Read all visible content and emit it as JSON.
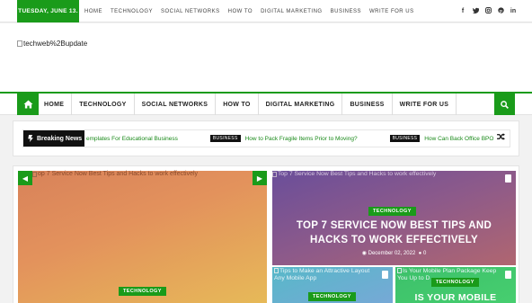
{
  "topbar": {
    "date": "TUESDAY, JUNE 13.",
    "nav": [
      "HOME",
      "TECHNOLOGY",
      "SOCIAL NETWORKS",
      "HOW TO",
      "DIGITAL MARKETING",
      "BUSINESS",
      "WRITE FOR US"
    ],
    "social_icons": [
      "facebook-icon",
      "twitter-icon",
      "instagram-icon",
      "pinterest-icon",
      "linkedin-icon"
    ]
  },
  "logo": {
    "alt": "techweb%2Bupdate"
  },
  "mainnav": {
    "items": [
      "HOME",
      "TECHNOLOGY",
      "SOCIAL NETWORKS",
      "HOW TO",
      "DIGITAL MARKETING",
      "BUSINESS",
      "WRITE FOR US"
    ],
    "home_icon": "home-icon",
    "search_icon": "search-icon"
  },
  "ticker": {
    "label": "Breaking News",
    "items": [
      {
        "badge": "",
        "text": "emplates For Educational Business"
      },
      {
        "badge": "BUSINESS",
        "text": "How to Pack Fragile Items Prior to Moving?"
      },
      {
        "badge": "BUSINESS",
        "text": "How Can Back Office BPO"
      }
    ]
  },
  "slider": {
    "caption": "op 7 Service Now Best Tips and Hacks to work effectively",
    "category": "TECHNOLOGY"
  },
  "featured": {
    "caption": "Top 7 Service Now Best Tips and Hacks to work effectively",
    "category": "TECHNOLOGY",
    "title": "TOP 7 SERVICE NOW BEST TIPS AND HACKS TO WORK EFFECTIVELY",
    "date": "December 02, 2022",
    "comments": "0"
  },
  "card2": {
    "caption_line1": "Tips to Make an Attractive Layout",
    "caption_line2": "Any Mobile App",
    "category": "TECHNOLOGY"
  },
  "card3": {
    "caption_line1": "Is Your Mobile Plan Package Keep",
    "caption_line2": "You Up to D",
    "category": "TECHNOLOGY",
    "title": "IS YOUR MOBILE"
  },
  "colors": {
    "accent": "#1a9b1a",
    "dark": "#111111"
  }
}
